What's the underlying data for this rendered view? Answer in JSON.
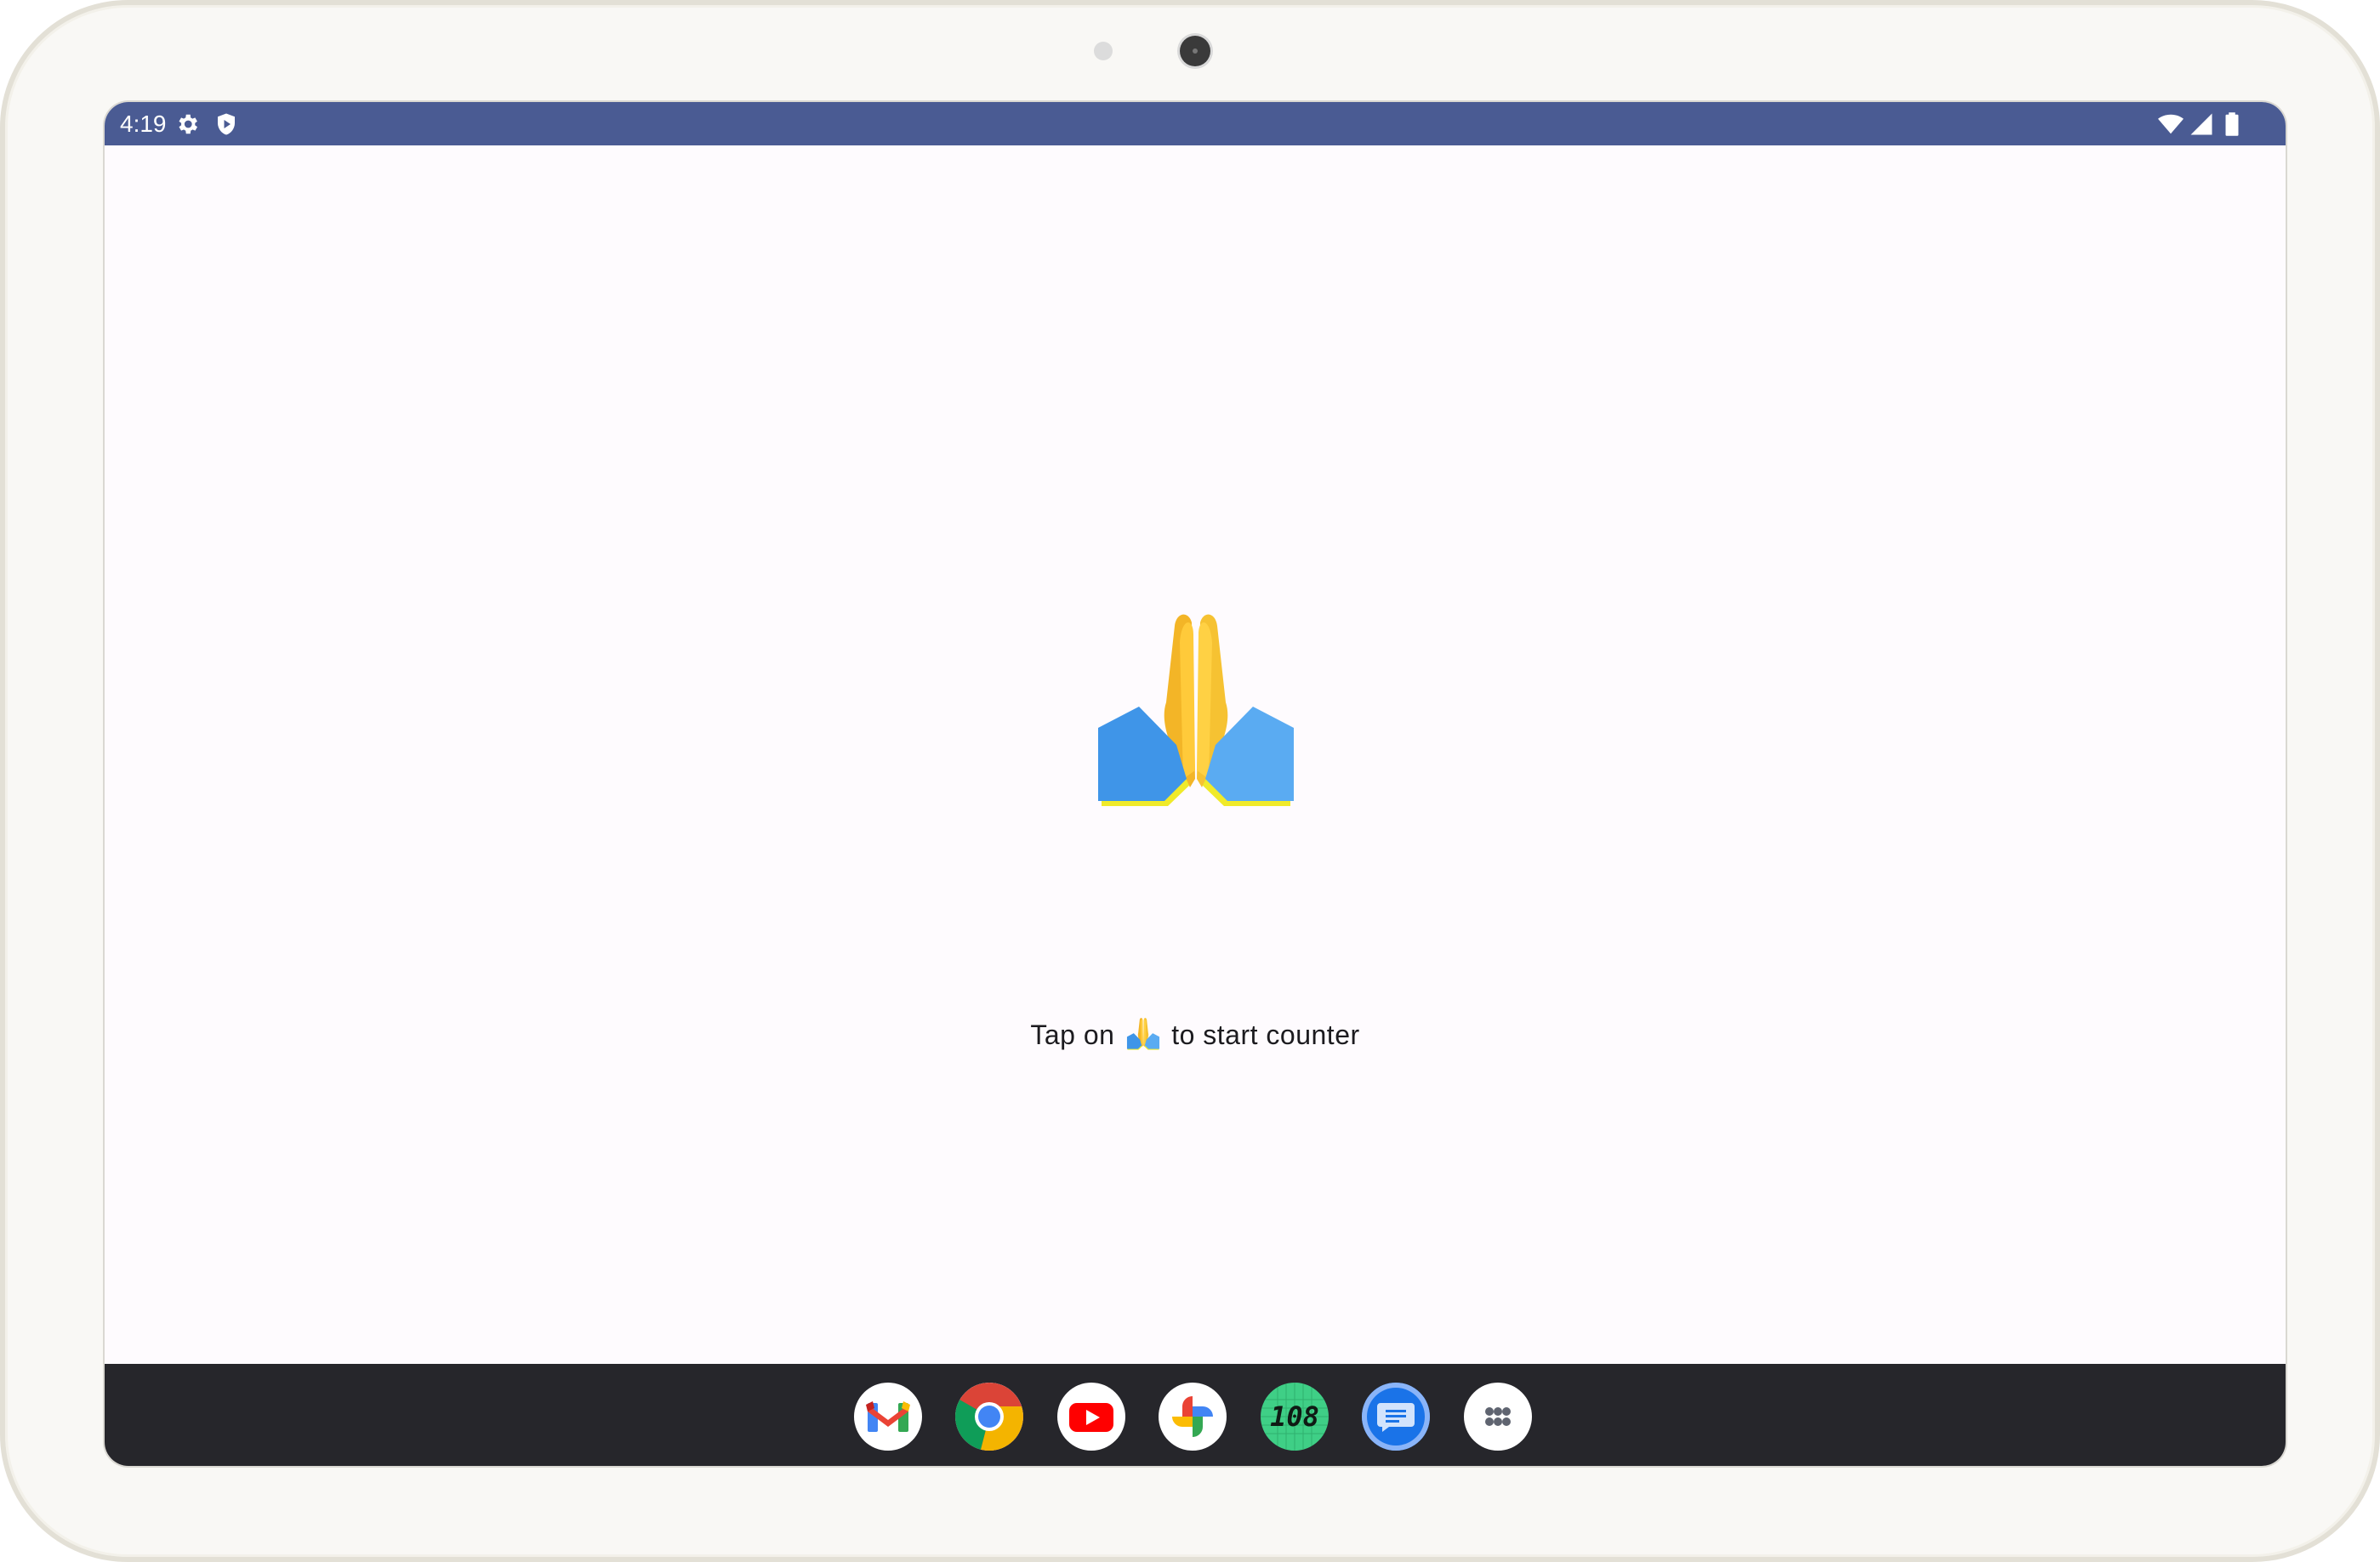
{
  "status_bar": {
    "time": "4:19",
    "left_icons": [
      "gear-icon",
      "shield-play-icon"
    ],
    "right_icons": [
      "wifi-icon",
      "cellular-signal-icon",
      "battery-icon"
    ],
    "color": "#4a5b93"
  },
  "main": {
    "emoji": "🙏",
    "hint_before": "Tap on",
    "hint_after": "to start counter"
  },
  "dock": {
    "apps": [
      {
        "name": "Gmail",
        "icon": "gmail-icon"
      },
      {
        "name": "Chrome",
        "icon": "chrome-icon"
      },
      {
        "name": "YouTube",
        "icon": "youtube-icon"
      },
      {
        "name": "Photos",
        "icon": "photos-icon"
      },
      {
        "name": "Counter",
        "icon": "counter-108-icon",
        "label": "108"
      },
      {
        "name": "Messages",
        "icon": "messages-icon"
      },
      {
        "name": "All apps",
        "icon": "app-drawer-icon"
      }
    ],
    "color": "#26262b"
  }
}
